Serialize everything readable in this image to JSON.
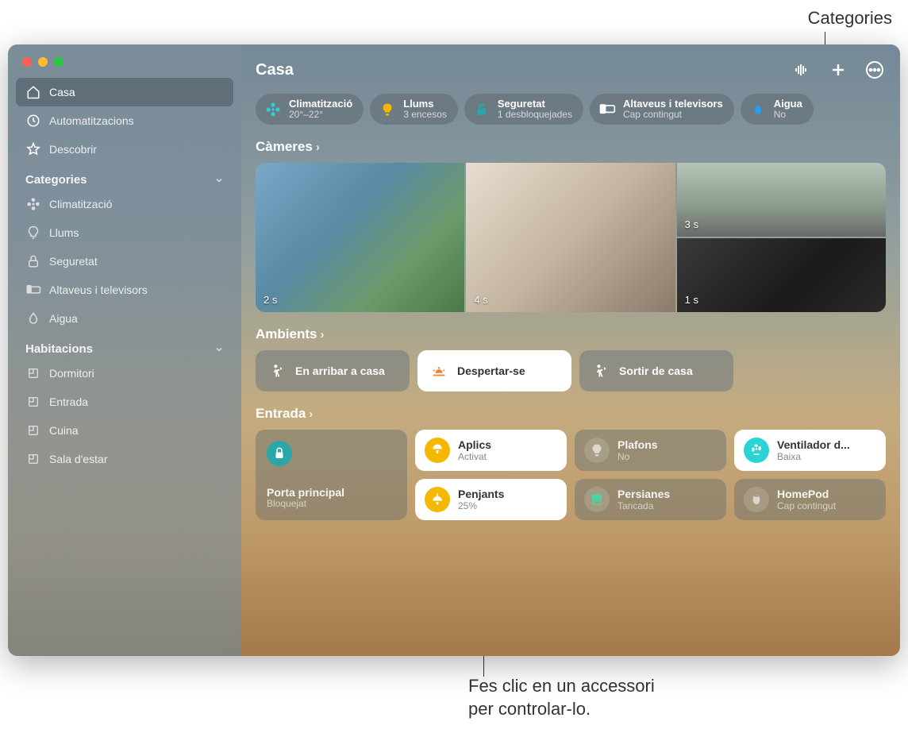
{
  "annotations": {
    "categories": "Categories",
    "accessory_click": "Fes clic en un accessori\nper controlar-lo."
  },
  "sidebar": {
    "nav": [
      {
        "label": "Casa"
      },
      {
        "label": "Automatitzacions"
      },
      {
        "label": "Descobrir"
      }
    ],
    "categories_heading": "Categories",
    "categories": [
      {
        "label": "Climatització"
      },
      {
        "label": "Llums"
      },
      {
        "label": "Seguretat"
      },
      {
        "label": "Altaveus i televisors"
      },
      {
        "label": "Aigua"
      }
    ],
    "rooms_heading": "Habitacions",
    "rooms": [
      {
        "label": "Dormitori"
      },
      {
        "label": "Entrada"
      },
      {
        "label": "Cuina"
      },
      {
        "label": "Sala d'estar"
      }
    ]
  },
  "header": {
    "title": "Casa"
  },
  "pills": [
    {
      "label": "Climatització",
      "sub": "20°–22°",
      "icon": "fan",
      "color": "#2ad4d4"
    },
    {
      "label": "Llums",
      "sub": "3 encesos",
      "icon": "bulb",
      "color": "#f5b800"
    },
    {
      "label": "Seguretat",
      "sub": "1 desbloquejades",
      "icon": "lock",
      "color": "#2aa8a8"
    },
    {
      "label": "Altaveus i televisors",
      "sub": "Cap contingut",
      "icon": "tv",
      "color": "#ffffff"
    },
    {
      "label": "Aigua",
      "sub": "No",
      "icon": "drop",
      "color": "#1ea0ff"
    }
  ],
  "sections": {
    "cameras": "Càmeres",
    "scenes": "Ambients",
    "room": "Entrada"
  },
  "cameras": [
    {
      "ts": "2 s"
    },
    {
      "ts": "3 s"
    },
    {
      "ts": "1 s"
    },
    {
      "ts": "4 s"
    }
  ],
  "scenes": [
    {
      "label": "En arribar a casa",
      "active": false
    },
    {
      "label": "Despertar-se",
      "active": true
    },
    {
      "label": "Sortir de casa",
      "active": false
    }
  ],
  "tiles": {
    "door": {
      "label": "Porta principal",
      "sub": "Bloquejat"
    },
    "aplics": {
      "label": "Aplics",
      "sub": "Activat"
    },
    "plafons": {
      "label": "Plafons",
      "sub": "No"
    },
    "fan": {
      "label": "Ventilador d...",
      "sub": "Baixa"
    },
    "penjants": {
      "label": "Penjants",
      "sub": "25%"
    },
    "persianes": {
      "label": "Persianes",
      "sub": "Tancada"
    },
    "homepod": {
      "label": "HomePod",
      "sub": "Cap contingut"
    }
  }
}
